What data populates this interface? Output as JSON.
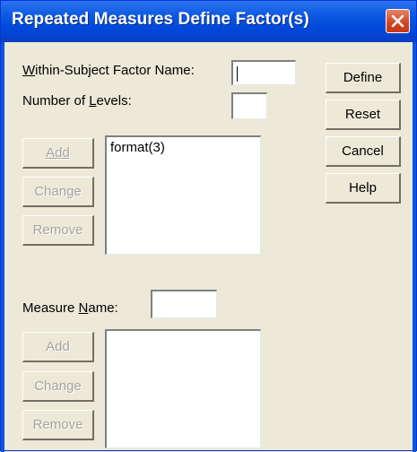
{
  "window": {
    "title": "Repeated Measures Define Factor(s)"
  },
  "factor": {
    "name_label": "Within-Subject Factor Name:",
    "name_value": "",
    "levels_label": "Number of Levels:",
    "levels_value": "",
    "add_label": "Add",
    "change_label": "Change",
    "remove_label": "Remove",
    "list_items": [
      "format(3)"
    ]
  },
  "actions": {
    "define_label": "Define",
    "reset_label": "Reset",
    "cancel_label": "Cancel",
    "help_label": "Help"
  },
  "measure": {
    "name_label": "Measure Name:",
    "name_value": "",
    "add_label": "Add",
    "change_label": "Change",
    "remove_label": "Remove",
    "list_items": []
  },
  "icons": {
    "close": "close-icon"
  },
  "colors": {
    "titlebar": "#0a55e0",
    "dialog_bg": "#ece9d8",
    "close_button": "#d2431d",
    "disabled_text": "#a4a39c"
  }
}
